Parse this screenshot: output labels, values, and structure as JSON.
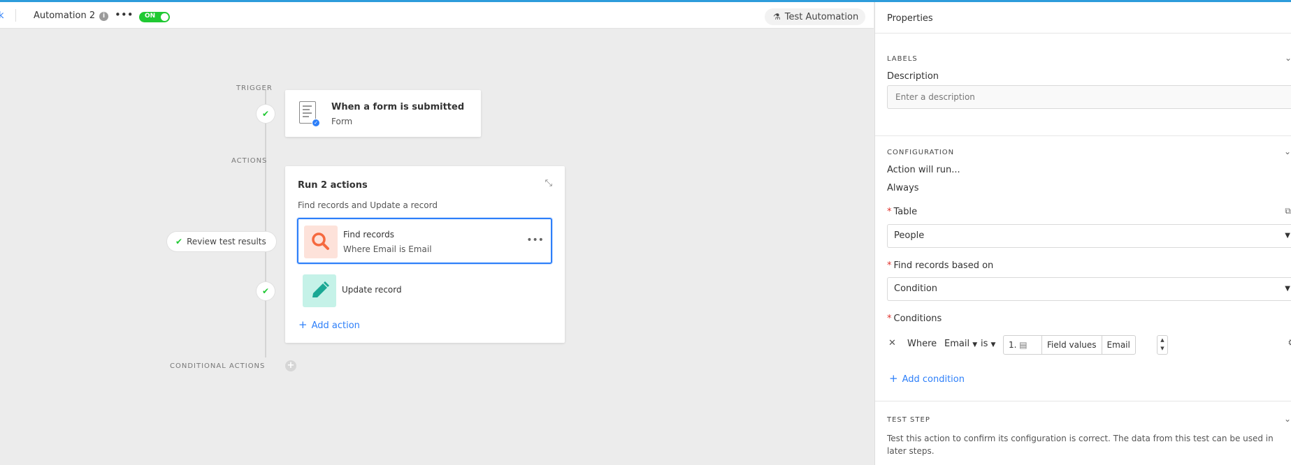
{
  "header": {
    "back_label": "k",
    "automation_name": "Automation 2",
    "toggle_label": "ON",
    "test_button_label": "Test Automation"
  },
  "canvas": {
    "trigger_label": "TRIGGER",
    "actions_label": "ACTIONS",
    "conditional_actions_label": "CONDITIONAL ACTIONS",
    "trigger": {
      "title": "When a form is submitted",
      "subtitle": "Form"
    },
    "actions_group": {
      "title": "Run 2 actions",
      "description": "Find records and Update a record",
      "steps": [
        {
          "title": "Find records",
          "subtitle": "Where Email is Email",
          "icon": "search-icon",
          "color": "#f5693f"
        },
        {
          "title": "Update record",
          "subtitle": "",
          "icon": "pencil-icon",
          "color": "#1aa894"
        }
      ],
      "add_action_label": "Add action"
    },
    "review_label": "Review test results"
  },
  "panel": {
    "title": "Properties",
    "labels_section": {
      "heading": "LABELS",
      "description_label": "Description",
      "description_placeholder": "Enter a description"
    },
    "configuration_section": {
      "heading": "CONFIGURATION",
      "action_will_run_label": "Action will run...",
      "action_will_run_value": "Always",
      "table_label": "Table",
      "table_value": "People",
      "find_based_on_label": "Find records based on",
      "find_based_on_value": "Condition",
      "conditions_label": "Conditions",
      "condition": {
        "where": "Where",
        "field": "Email",
        "operator": "is",
        "token_number": "1.",
        "token_source": "Field values",
        "token_field": "Email"
      },
      "add_condition_label": "Add condition"
    },
    "test_step_section": {
      "heading": "TEST STEP",
      "description": "Test this action to confirm its configuration is correct. The data from this test can be used in later steps."
    }
  },
  "colors": {
    "accent": "#2d7ff9",
    "toggle_on": "#20c933",
    "required": "#e0312b"
  }
}
